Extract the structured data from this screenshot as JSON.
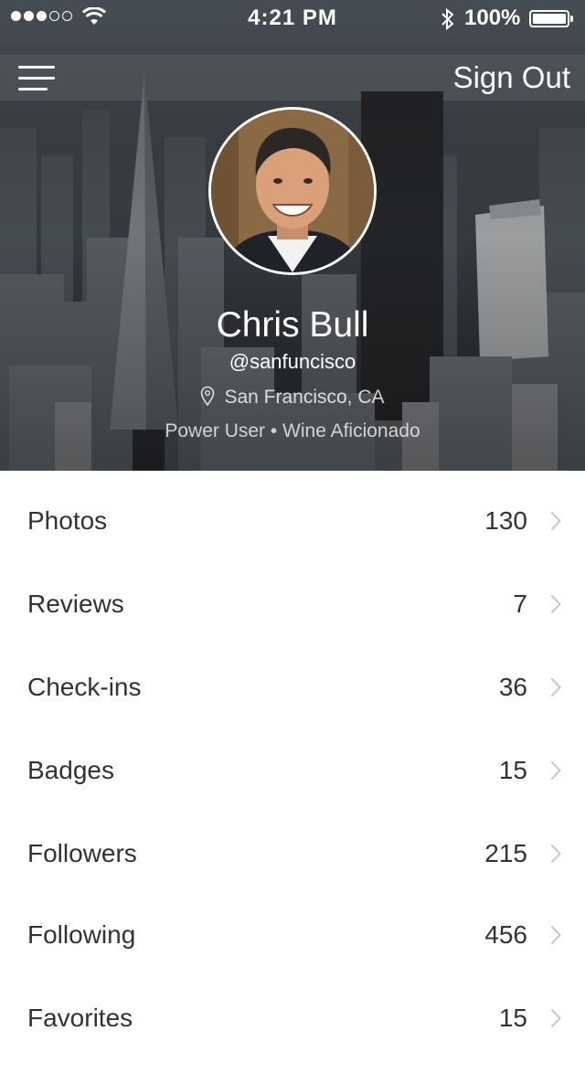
{
  "status_bar": {
    "signal_bars_filled": 3,
    "signal_bars_total": 5,
    "time": "4:21 PM",
    "battery_percent": "100%"
  },
  "header": {
    "menu_icon": "hamburger-menu-icon",
    "sign_out_label": "Sign Out"
  },
  "profile": {
    "name": "Chris Bull",
    "handle": "@sanfuncisco",
    "location": "San Francisco, CA",
    "tags": "Power User • Wine Aficionado"
  },
  "stats": [
    {
      "label": "Photos",
      "count": "130"
    },
    {
      "label": "Reviews",
      "count": "7"
    },
    {
      "label": "Check-ins",
      "count": "36"
    },
    {
      "label": "Badges",
      "count": "15"
    },
    {
      "label": "Followers",
      "count": "215"
    },
    {
      "label": "Following",
      "count": "456"
    },
    {
      "label": "Favorites",
      "count": "15"
    }
  ],
  "colors": {
    "text_primary": "#333333",
    "chevron": "#c7c7cc",
    "header_overlay": "#3b3f44"
  }
}
